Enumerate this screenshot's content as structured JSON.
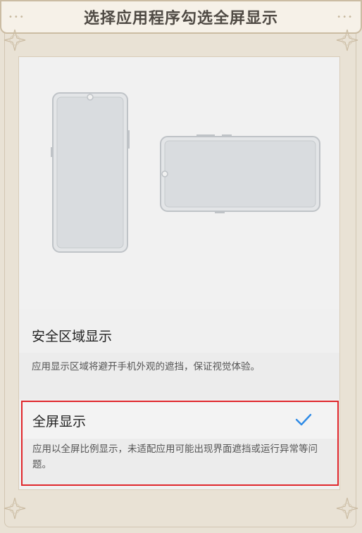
{
  "header": {
    "title": "选择应用程序勾选全屏显示"
  },
  "options": [
    {
      "title": "安全区域显示",
      "description": "应用显示区域将避开手机外观的遮挡，保证视觉体验。",
      "selected": false
    },
    {
      "title": "全屏显示",
      "description": "应用以全屏比例显示，未适配应用可能出现界面遮挡或运行异常等问题。",
      "selected": true
    }
  ],
  "colors": {
    "check": "#2d8ae6",
    "highlight_border": "#e0262b"
  }
}
